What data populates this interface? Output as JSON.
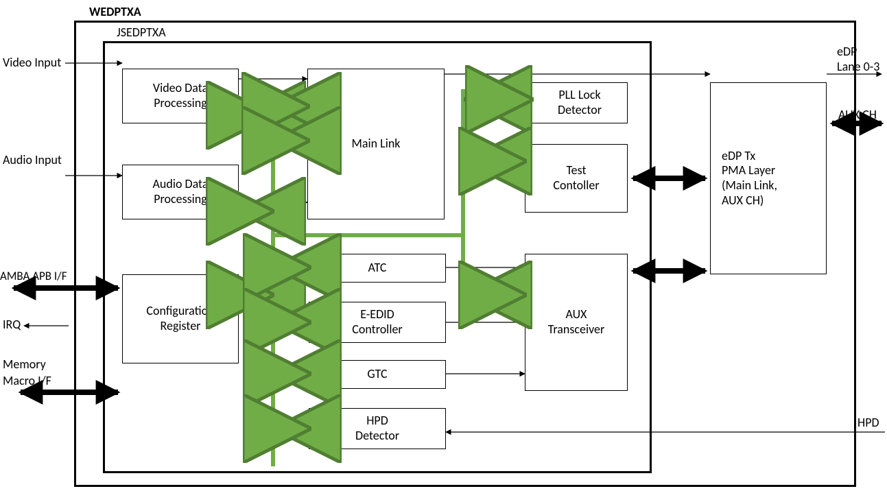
{
  "outer": {
    "title": "WEDPTXA"
  },
  "inner": {
    "title": "JSEDPTXA"
  },
  "ports": {
    "video_in": "Video Input",
    "audio_in": "Audio Input",
    "amba": "AMBA APB I/F",
    "irq": "IRQ",
    "mem_l1": "Memory",
    "mem_l2": "Macro I/F",
    "edp_l1": "eDP",
    "edp_l2": "Lane 0-3",
    "aux": "AUX CH",
    "hpd": "HPD"
  },
  "blocks": {
    "vdp_l1": "Video Data",
    "vdp_l2": "Processing",
    "adp_l1": "Audio Data",
    "adp_l2": "Processing",
    "cfg_l1": "Configuration",
    "cfg_l2": "Register",
    "main": "Main Link",
    "pll_l1": "PLL Lock",
    "pll_l2": "Detector",
    "test_l1": "Test",
    "test_l2": "Contoller",
    "atc": "ATC",
    "eedid_l1": "E-EDID",
    "eedid_l2": "Controller",
    "gtc": "GTC",
    "hpdd_l1": "HPD",
    "hpdd_l2": "Detector",
    "auxt_l1": "AUX",
    "auxt_l2": "Transceiver",
    "pma_l1": "eDP Tx",
    "pma_l2": "PMA Layer",
    "pma_l3": "(Main Link,",
    "pma_l4": "AUX CH)"
  }
}
